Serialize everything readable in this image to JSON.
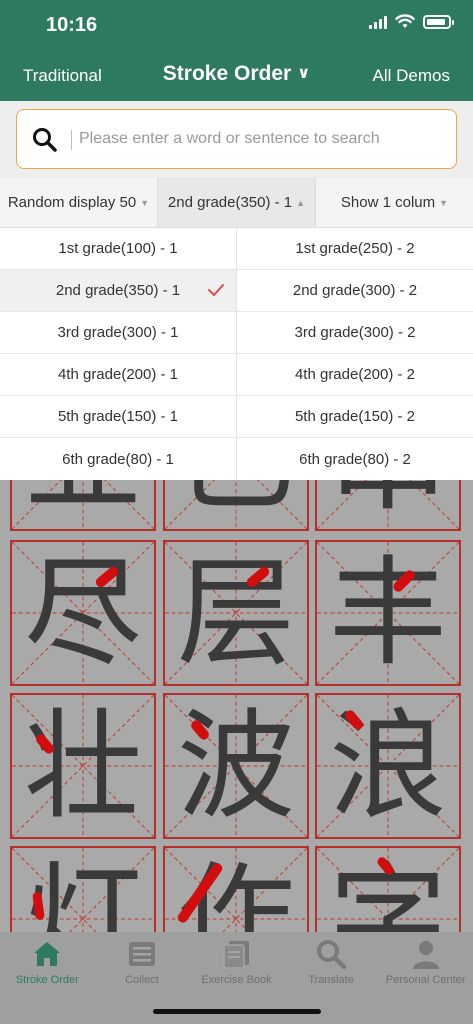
{
  "status": {
    "time": "10:16"
  },
  "nav": {
    "left": "Traditional",
    "title": "Stroke Order",
    "right": "All Demos"
  },
  "search": {
    "placeholder": "Please enter a word or sentence to search"
  },
  "filters": [
    {
      "label": "Random display 50"
    },
    {
      "label": "2nd grade(350) - 1"
    },
    {
      "label": "Show 1 colum"
    }
  ],
  "dropdown": {
    "left": [
      "1st grade(100) - 1",
      "2nd grade(350) - 1",
      "3rd grade(300) - 1",
      "4th grade(200) - 1",
      "5th grade(150) - 1",
      "6th grade(80) - 1"
    ],
    "right": [
      "1st grade(250) - 2",
      "2nd grade(300) - 2",
      "3rd grade(300) - 2",
      "4th grade(200) - 2",
      "5th grade(150) - 2",
      "6th grade(80) - 2"
    ],
    "selected_left_index": 1
  },
  "characters": {
    "partial_top": [
      "业",
      "已",
      "串"
    ],
    "row1": [
      "尽",
      "层",
      "丰"
    ],
    "row2": [
      "壮",
      "波",
      "浪"
    ],
    "row3": [
      "灯",
      "作",
      "字"
    ]
  },
  "tabs": [
    {
      "label": "Stroke Order",
      "icon": "home-icon",
      "active": true
    },
    {
      "label": "Collect",
      "icon": "list-icon",
      "active": false
    },
    {
      "label": "Exercise Book",
      "icon": "book-icon",
      "active": false
    },
    {
      "label": "Translate",
      "icon": "search-icon",
      "active": false
    },
    {
      "label": "Personal Center",
      "icon": "person-icon",
      "active": false
    }
  ],
  "colors": {
    "brand": "#2e7a5f",
    "search_border": "#f2a545",
    "grid_red": "#b3302c",
    "stroke_highlight": "#d10d0d",
    "check": "#e04848"
  }
}
